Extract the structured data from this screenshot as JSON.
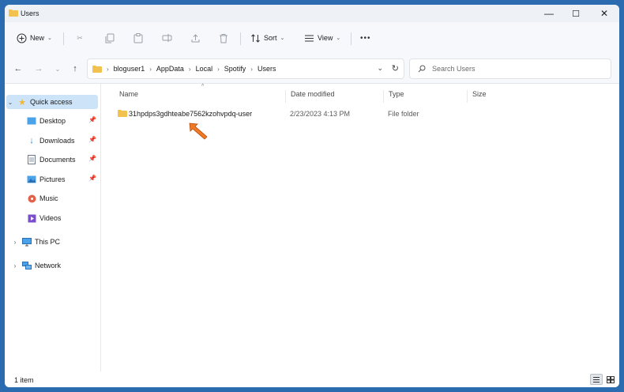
{
  "window": {
    "title": "Users",
    "controls": {
      "minimize": "—",
      "maximize": "☐",
      "close": "✕"
    }
  },
  "toolbar": {
    "new_label": "New",
    "sort_label": "Sort",
    "view_label": "View",
    "more_label": "•••"
  },
  "address_bar": {
    "breadcrumbs": [
      "bloguser1",
      "AppData",
      "Local",
      "Spotify",
      "Users"
    ]
  },
  "search": {
    "placeholder": "Search Users"
  },
  "sidebar": {
    "quick_access": "Quick access",
    "items": [
      {
        "label": "Desktop",
        "icon": "desktop-icon",
        "pinned": true
      },
      {
        "label": "Downloads",
        "icon": "downloads-icon",
        "pinned": true
      },
      {
        "label": "Documents",
        "icon": "documents-icon",
        "pinned": true
      },
      {
        "label": "Pictures",
        "icon": "pictures-icon",
        "pinned": true
      },
      {
        "label": "Music",
        "icon": "music-icon",
        "pinned": false
      },
      {
        "label": "Videos",
        "icon": "videos-icon",
        "pinned": false
      }
    ],
    "this_pc": "This PC",
    "network": "Network"
  },
  "columns": {
    "name": "Name",
    "date_modified": "Date modified",
    "type": "Type",
    "size": "Size"
  },
  "files": [
    {
      "name": "31hpdps3gdhteabe7562kzohvpdq-user",
      "date_modified": "2/23/2023 4:13 PM",
      "type": "File folder",
      "size": ""
    }
  ],
  "status": {
    "item_count": "1 item"
  },
  "colors": {
    "accent": "#2b6cb0",
    "selection": "#cde3f7",
    "folder": "#f2c14e",
    "arrow": "#f07a24"
  }
}
